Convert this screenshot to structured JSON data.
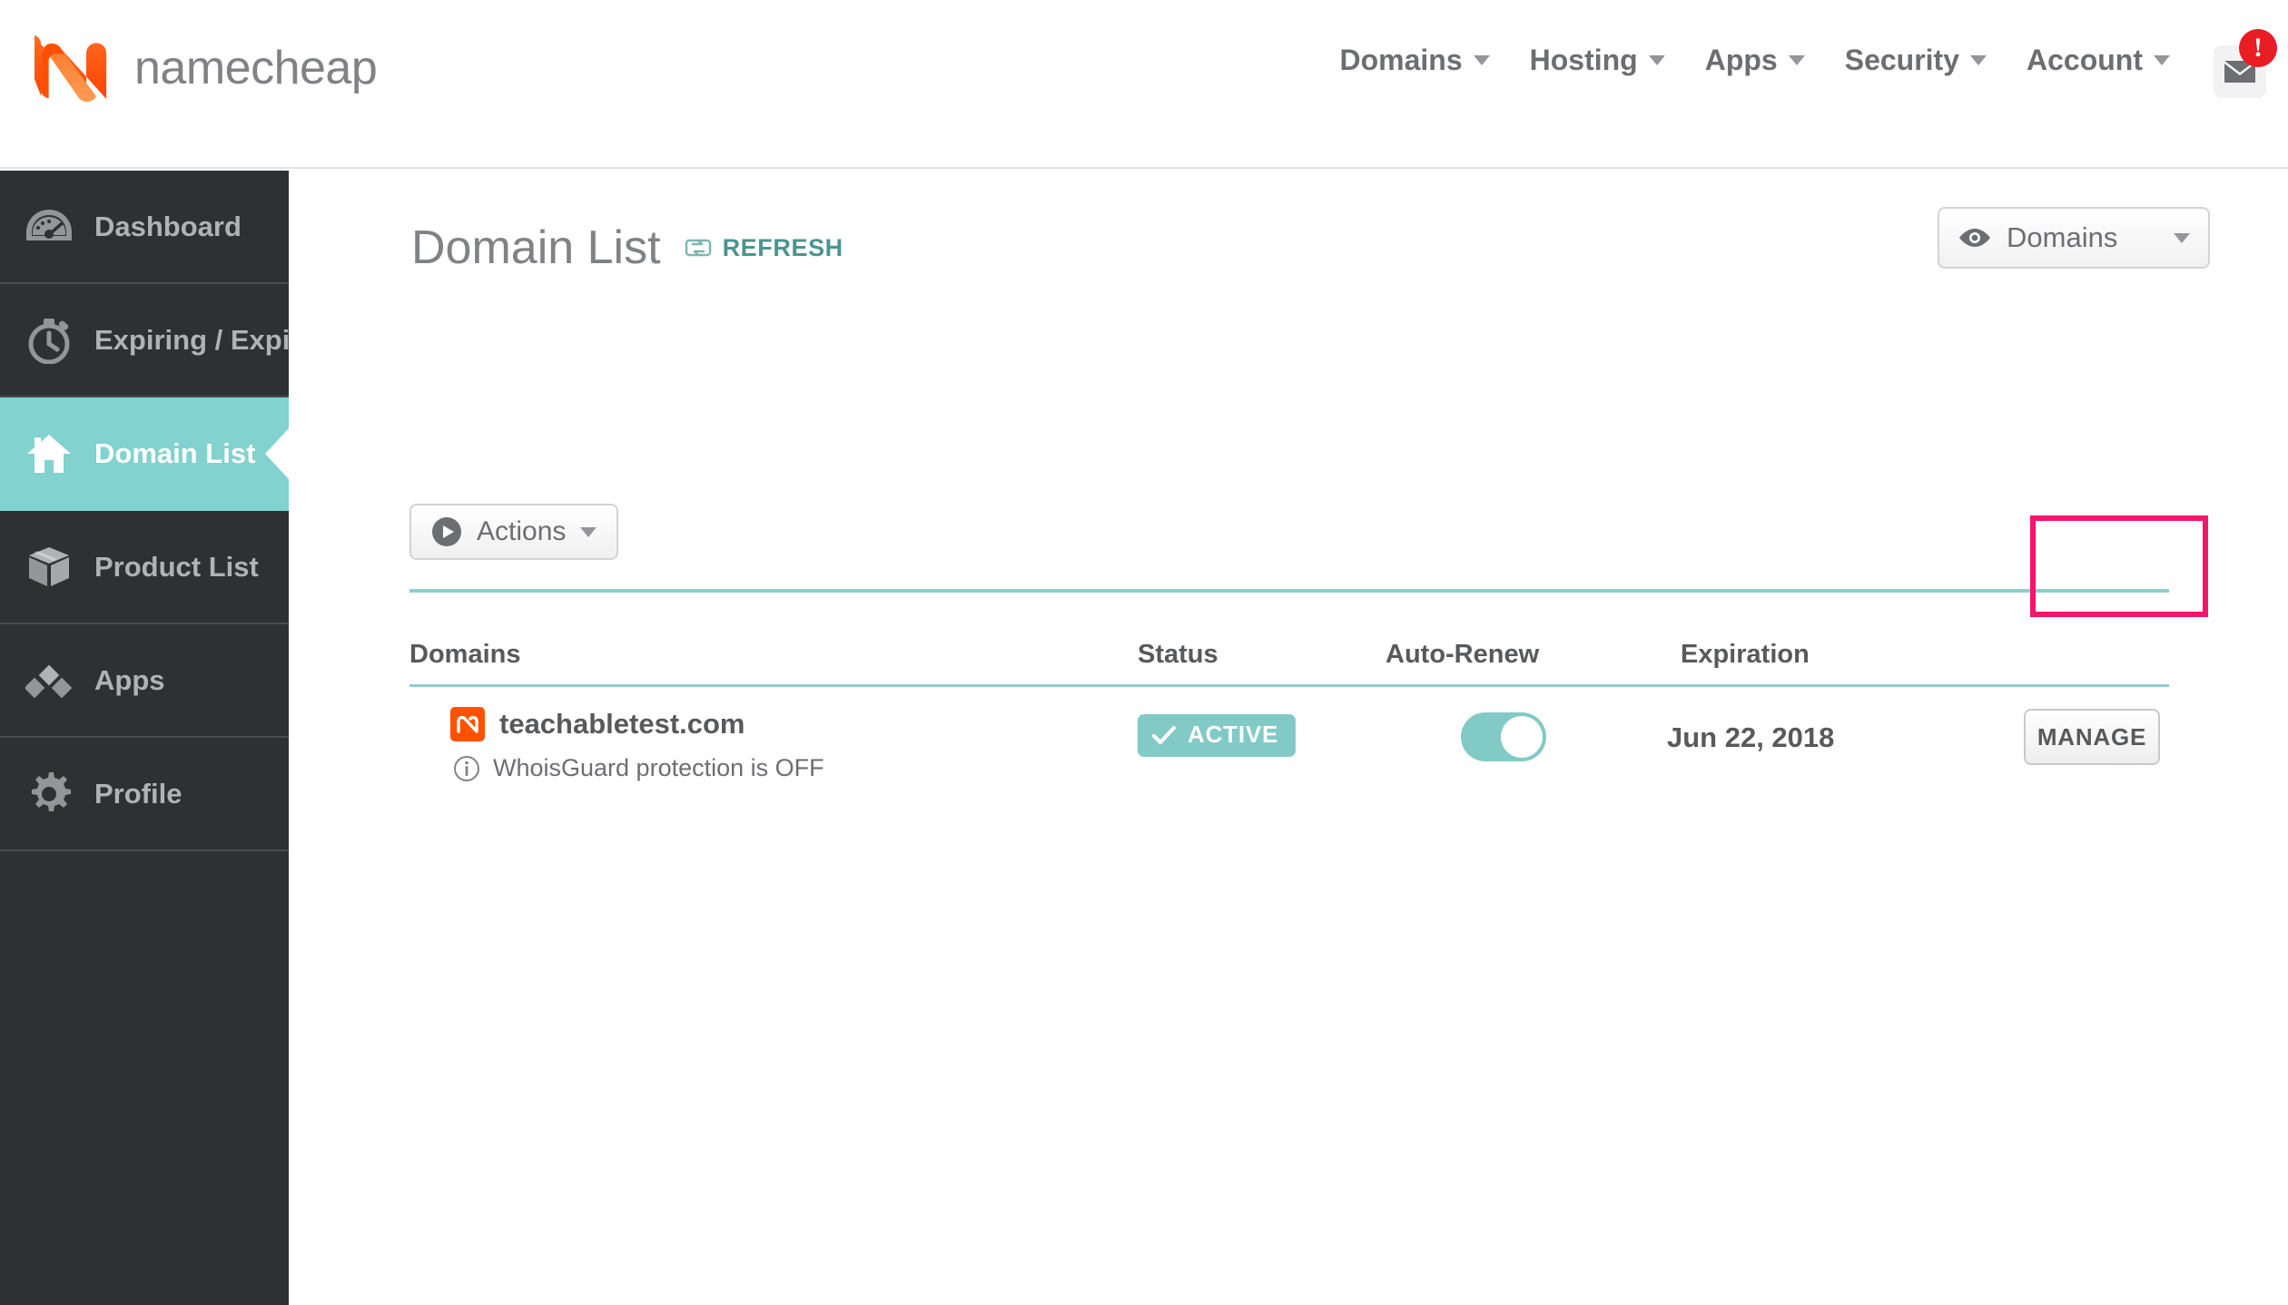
{
  "brand": {
    "name": "namecheap",
    "logo_icon": "namecheap-n-logo",
    "logo_color": "#ff5100"
  },
  "top_nav": {
    "items": [
      {
        "label": "Domains",
        "icon": "chevron-down-icon"
      },
      {
        "label": "Hosting",
        "icon": "chevron-down-icon"
      },
      {
        "label": "Apps",
        "icon": "chevron-down-icon"
      },
      {
        "label": "Security",
        "icon": "chevron-down-icon"
      },
      {
        "label": "Account",
        "icon": "chevron-down-icon"
      }
    ],
    "mail": {
      "icon": "envelope-icon",
      "badge": "!",
      "badge_color": "#ea1c24"
    }
  },
  "sidebar": {
    "background": "#2e3032",
    "active_color": "#82d2cf",
    "items": [
      {
        "label": "Dashboard",
        "icon": "speedometer-icon",
        "active": false
      },
      {
        "label": "Expiring / Expired",
        "icon": "stopwatch-icon",
        "active": false
      },
      {
        "label": "Domain List",
        "icon": "house-icon",
        "active": true
      },
      {
        "label": "Product List",
        "icon": "box-icon",
        "active": false
      },
      {
        "label": "Apps",
        "icon": "diamonds-icon",
        "active": false
      },
      {
        "label": "Profile",
        "icon": "gear-icon",
        "active": false
      }
    ]
  },
  "page": {
    "title": "Domain List",
    "refresh_label": "REFRESH",
    "refresh_icon": "refresh-icon",
    "refresh_color": "#4c9490",
    "view_select": {
      "label": "Domains",
      "icon": "eye-icon",
      "caret": "chevron-down-icon"
    },
    "actions_button": {
      "label": "Actions",
      "icon": "play-circle-icon",
      "caret": "chevron-down-icon"
    }
  },
  "table": {
    "accent_color": "#8ecfcb",
    "headers": {
      "domains": "Domains",
      "status": "Status",
      "auto_renew": "Auto-Renew",
      "expiration": "Expiration"
    },
    "rows": [
      {
        "favicon_icon": "namecheap-favicon",
        "domain": "teachabletest.com",
        "note_icon": "info-circle-icon",
        "note": "WhoisGuard protection is OFF",
        "status": "ACTIVE",
        "status_icon": "check-icon",
        "status_color": "#82cac5",
        "auto_renew": "on",
        "expiration": "Jun 22, 2018",
        "manage_label": "MANAGE"
      }
    ]
  },
  "annotation": {
    "type": "highlight-rectangle",
    "color": "#f5156c",
    "target": "manage-button"
  }
}
